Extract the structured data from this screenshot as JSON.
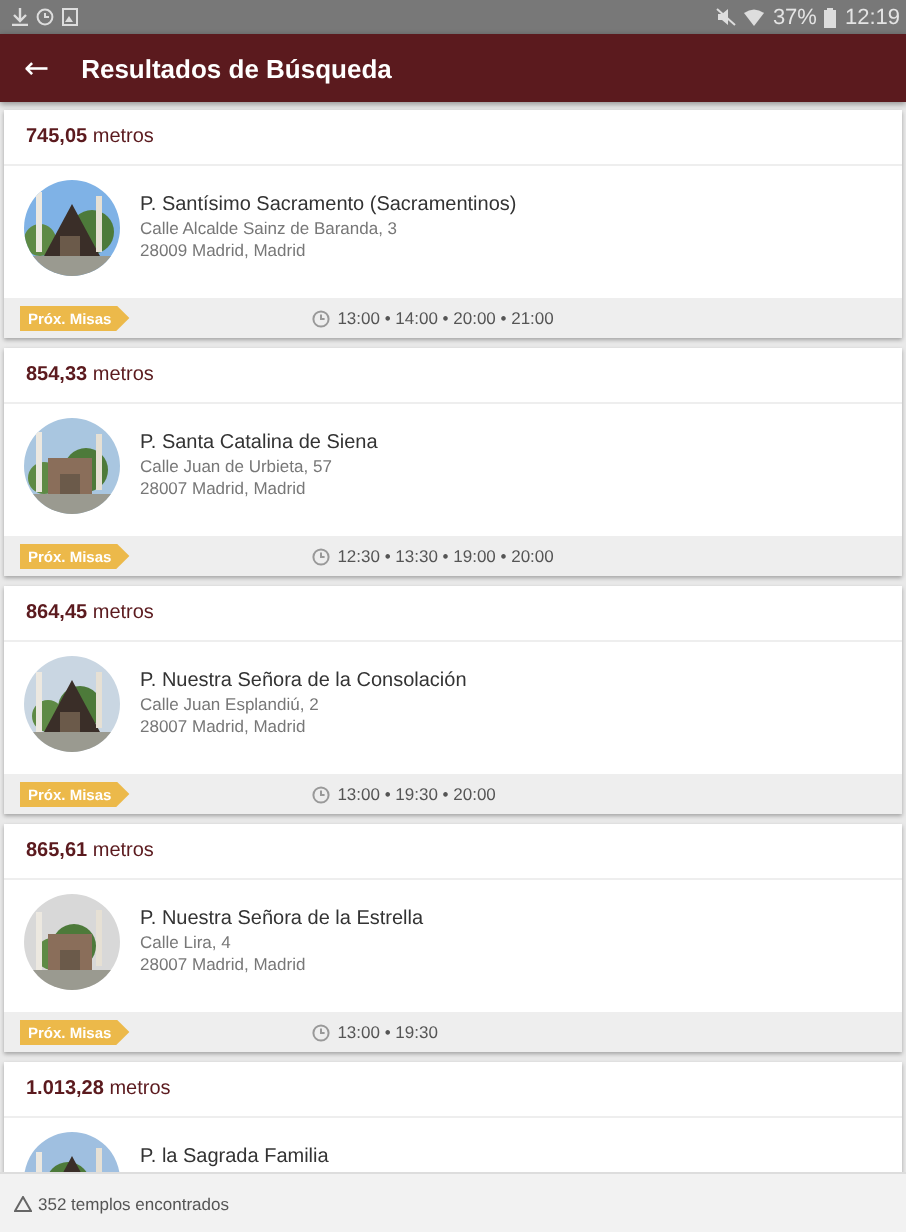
{
  "status_bar": {
    "battery": "37%",
    "time": "12:19"
  },
  "app_bar": {
    "back": "←",
    "title": "Resultados de Búsqueda"
  },
  "results": [
    {
      "distance": "**745,05** metros",
      "name": "P. Santísimo Sacramento (Sacramentinos)",
      "street": "Calle Alcalde Sainz de Baranda, 3",
      "city": "28009 Madrid, Madrid",
      "badge": "Próx. Misas",
      "times": "13:00 • 14:00 • 20:00 • 21:00"
    },
    {
      "distance": "**854,33** metros",
      "name": "P. Santa Catalina de Siena",
      "street": "Calle Juan de Urbieta, 57",
      "city": "28007 Madrid, Madrid",
      "badge": "Próx. Misas",
      "times": "12:30 • 13:30 • 19:00 • 20:00"
    },
    {
      "distance": "**864,45** metros",
      "name": "P. Nuestra Señora de la Consolación",
      "street": "Calle Juan Esplandiú, 2",
      "city": "28007 Madrid, Madrid",
      "badge": "Próx. Misas",
      "times": "13:00 • 19:30 • 20:00"
    },
    {
      "distance": "**865,61** metros",
      "name": "P. Nuestra Señora de la Estrella",
      "street": "Calle Lira, 4",
      "city": "28007 Madrid, Madrid",
      "badge": "Próx. Misas",
      "times": "13:00 • 19:30"
    },
    {
      "distance": "**1.013,28** metros",
      "name": "P. la Sagrada Familia"
    }
  ],
  "footer": {
    "count": "352 templos encontrados"
  }
}
